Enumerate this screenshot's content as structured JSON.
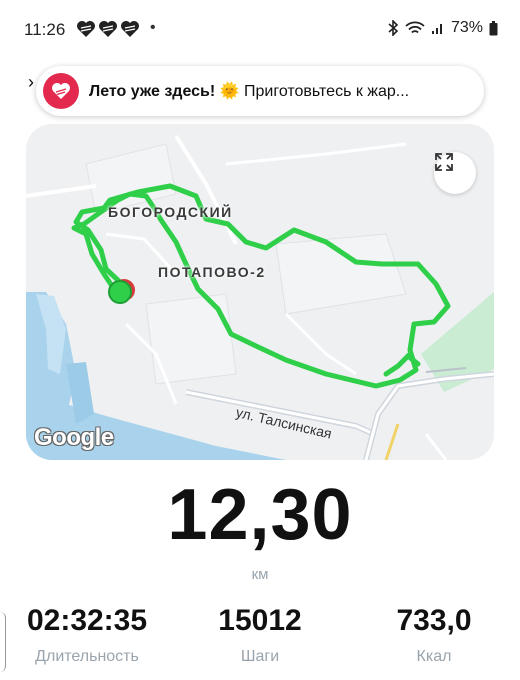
{
  "status_bar": {
    "time": "11:26",
    "dot": "•",
    "battery": "73%"
  },
  "banner": {
    "title": "Лето уже здесь!",
    "emoji": "🌞",
    "message": "Приготовьтесь к жар..."
  },
  "map": {
    "area_labels": [
      "БОГОРОДСКИЙ",
      "ПОТАПОВО-2"
    ],
    "street_label": "ул. Талсинская",
    "google_label": "Google",
    "route_color": "#2fcf4a",
    "start_marker_color": "#2fcf4a",
    "end_marker_color": "#d63a3a"
  },
  "workout": {
    "distance": "12,30",
    "distance_unit": "км",
    "stats": [
      {
        "value": "02:32:35",
        "label": "Длительность"
      },
      {
        "value": "15012",
        "label": "Шаги"
      },
      {
        "value": "733,0",
        "label": "Ккал"
      }
    ]
  }
}
